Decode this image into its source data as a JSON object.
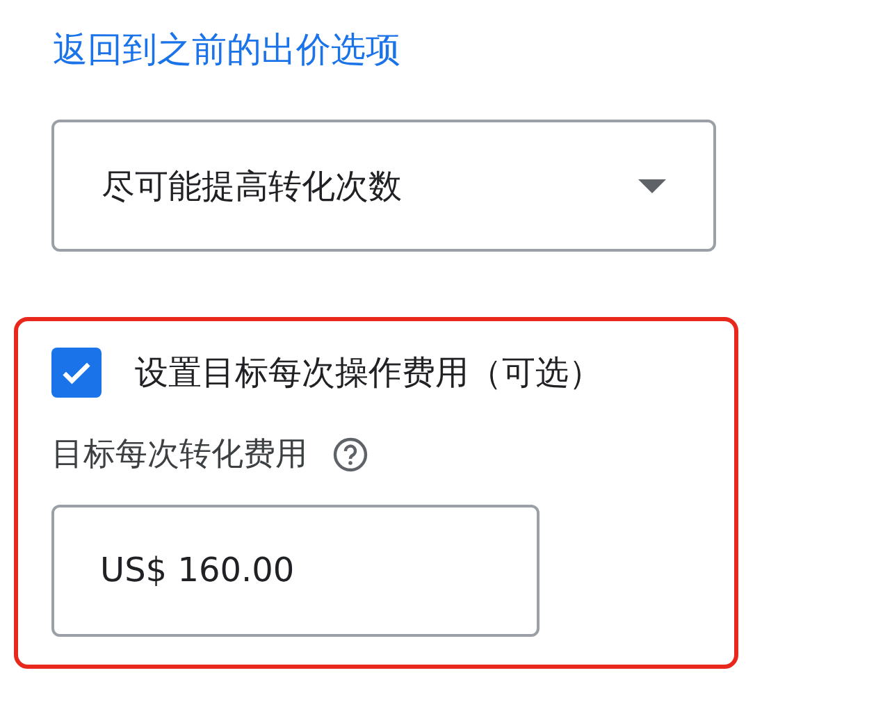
{
  "back_link": "返回到之前的出价选项",
  "bid_strategy": {
    "value": "尽可能提高转化次数"
  },
  "target_option": {
    "label": "设置目标每次操作费用（可选）",
    "checked": true
  },
  "target_field": {
    "label": "目标每次转化费用",
    "value": "US$ 160.00"
  }
}
